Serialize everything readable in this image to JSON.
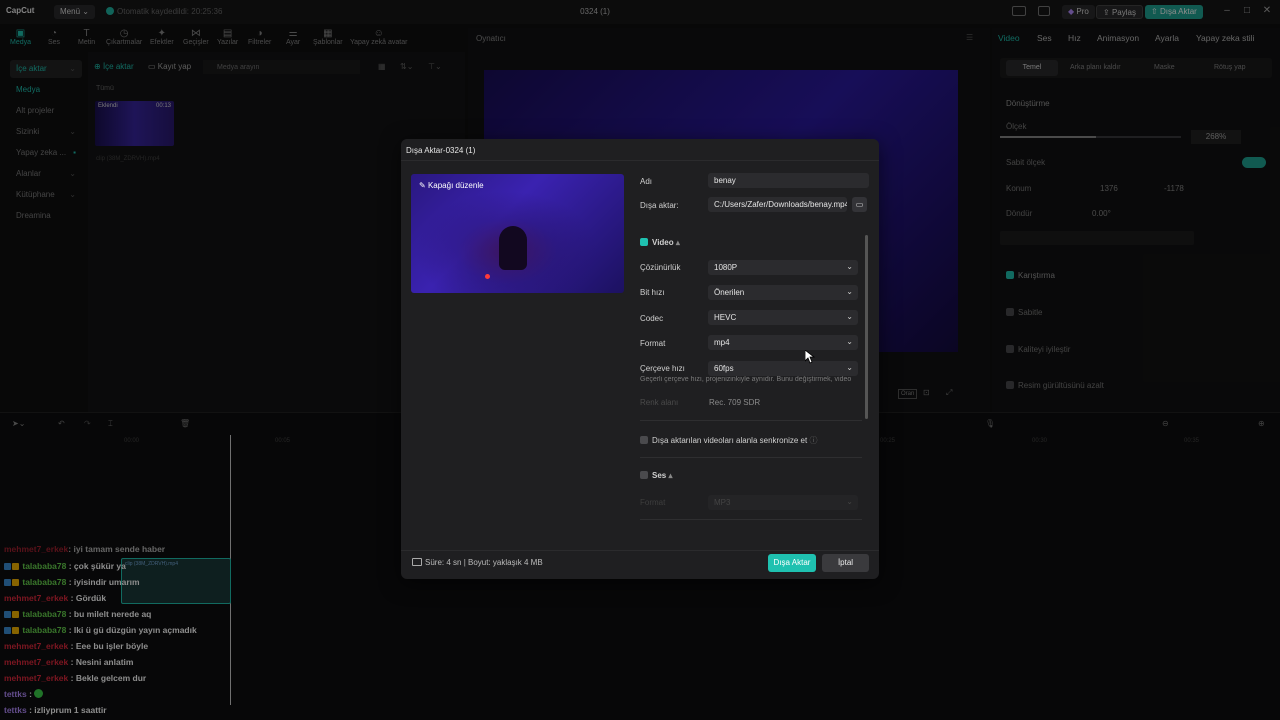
{
  "titlebar": {
    "logo": "CapCut",
    "menu": "Menü",
    "autosave": "Otomatik kaydedildi: 20:25:36",
    "project_title": "0324 (1)",
    "pro": "Pro",
    "share": "Paylaş",
    "export": "Dışa Aktar"
  },
  "tools": [
    "Medya",
    "Ses",
    "Metin",
    "Çıkartmalar",
    "Efektler",
    "Geçişler",
    "Yazılar",
    "Filtreler",
    "Ayar",
    "Şablonlar",
    "Yapay zekâ avatar"
  ],
  "leftnav": [
    "İçe aktar",
    "Medya",
    "Alt projeler",
    "Sizinki",
    "Yapay zeka ...",
    "Alanlar",
    "Kütüphane",
    "Dreamina"
  ],
  "media": {
    "import": "İçe aktar",
    "record": "Kayıt yap",
    "search_placeholder": "Medya arayın",
    "all_label": "Tümü",
    "clip_badge": "Eklendi",
    "clip_duration": "00:13",
    "clip_name": "clip (38M_ZDRVH).mp4"
  },
  "player": {
    "label": "Oynatıcı",
    "ratio": "Oran"
  },
  "inspector": {
    "tabs": [
      "Video",
      "Ses",
      "Hız",
      "Animasyon",
      "Ayarla",
      "Yapay zeka stili"
    ],
    "subtabs": [
      "Temel",
      "Arka planı kaldır",
      "Maske",
      "Rötuş yap"
    ],
    "transform": "Dönüştürme",
    "scale": "Ölçek",
    "scale_value": "268%",
    "uniform_scale": "Sabit ölçek",
    "position": "Konum",
    "pos_x": "1376",
    "pos_y": "-1178",
    "rotate": "Döndür",
    "rotate_value": "0.00°",
    "blend": "Karıştırma",
    "stabilize": "Sabitle",
    "enhance": "Kaliteyi iyileştir",
    "denoise": "Resim gürültüsünü azalt"
  },
  "dialog": {
    "title": "Dışa Aktar-0324 (1)",
    "edit_cover": "Kapağı düzenle",
    "name_label": "Adı",
    "name_value": "benay",
    "export_to_label": "Dışa aktar:",
    "export_path": "C:/Users/Zafer/Downloads/benay.mp4",
    "video_section": "Video",
    "resolution_label": "Çözünürlük",
    "resolution_value": "1080P",
    "bitrate_label": "Bit hızı",
    "bitrate_value": "Önerilen",
    "codec_label": "Codec",
    "codec_value": "HEVC",
    "format_label": "Format",
    "format_value": "mp4",
    "fps_label": "Çerçeve hızı",
    "fps_value": "60fps",
    "fps_hint": "Geçerli çerçeve hızı, projenizinkiyle aynıdır. Bunu değiştirmek, video",
    "color_space_label": "Renk alanı",
    "color_space_value": "Rec. 709 SDR",
    "sync_label": "Dışa aktarılan videoları alanla senkronize et",
    "audio_section": "Ses",
    "audio_format_label": "Format",
    "audio_format_value": "MP3",
    "footer_info": "Süre: 4 sn | Boyut: yaklaşık 4 MB",
    "export_button": "Dışa Aktar",
    "cancel_button": "İptal"
  },
  "timeline": {
    "ticks": [
      "00:00",
      "00:05",
      "00:10",
      "00:15",
      "00:20",
      "00:25",
      "00:30",
      "00:35"
    ],
    "clip_label": "clip (38M_ZDRVH).mp4"
  },
  "chat": [
    {
      "user": "mehmet7_erkek",
      "text": ": iyi tamam sende haber",
      "color": "#e0283c",
      "badges": false
    },
    {
      "user": "talababa78",
      "text": ": çok şükür ya",
      "color": "#69d84f",
      "badges": true
    },
    {
      "user": "talababa78",
      "text": ": iyisindir umarım",
      "color": "#69d84f",
      "badges": true
    },
    {
      "user": "mehmet7_erkek",
      "text": ": Gördük",
      "color": "#e0283c",
      "badges": false
    },
    {
      "user": "talababa78",
      "text": ": bu milelt nerede aq",
      "color": "#69d84f",
      "badges": true
    },
    {
      "user": "talababa78",
      "text": ": Iki ü gü düzgün yayın açmadık",
      "color": "#69d84f",
      "badges": true
    },
    {
      "user": "mehmet7_erkek",
      "text": ": Eee bu işler böyle",
      "color": "#e0283c",
      "badges": false
    },
    {
      "user": "mehmet7_erkek",
      "text": ": Nesini anlatim",
      "color": "#e0283c",
      "badges": false
    },
    {
      "user": "mehmet7_erkek",
      "text": ": Bekle gelcem dur",
      "color": "#e0283c",
      "badges": false
    },
    {
      "user": "tettks",
      "text": ":",
      "color": "#b58cff",
      "badges": false
    },
    {
      "user": "tettks",
      "text": ": izliyprum 1 saattir",
      "color": "#b58cff",
      "badges": false
    }
  ],
  "colors": {
    "accent": "#1fc1b0",
    "dialog_bg": "#1f1f21"
  }
}
